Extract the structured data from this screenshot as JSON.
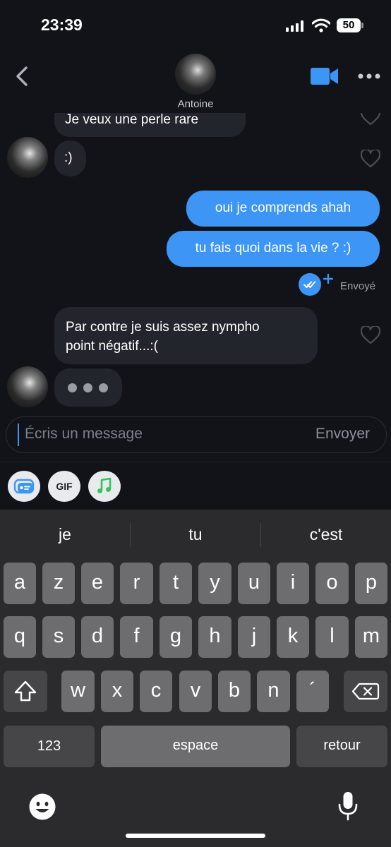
{
  "status_bar": {
    "time": "23:39",
    "battery": "50"
  },
  "header": {
    "contact_name": "Antoine"
  },
  "messages": {
    "partial_top": "Je veux une perle rare",
    "in_1": ":)",
    "out_1": "oui je comprends ahah",
    "out_2": "tu fais quoi dans la vie ? :)",
    "receipt": "Envoyé",
    "in_2_line1": "Par contre je suis assez nympho",
    "in_2_line2": "point négatif...:("
  },
  "composer": {
    "placeholder": "Écris un message",
    "send_label": "Envoyer",
    "gif_label": "GIF"
  },
  "keyboard": {
    "suggestions": [
      "je",
      "tu",
      "c'est"
    ],
    "row1": [
      "a",
      "z",
      "e",
      "r",
      "t",
      "y",
      "u",
      "i",
      "o",
      "p"
    ],
    "row2": [
      "q",
      "s",
      "d",
      "f",
      "g",
      "h",
      "j",
      "k",
      "l",
      "m"
    ],
    "row3": [
      "w",
      "x",
      "c",
      "v",
      "b",
      "n",
      "´"
    ],
    "numbers_label": "123",
    "space_label": "espace",
    "return_label": "retour"
  },
  "colors": {
    "accent": "#3d96f5",
    "background": "#111318",
    "incoming_bubble": "#23252d"
  },
  "icons": [
    "back-chevron-icon",
    "video-call-icon",
    "more-icon",
    "heart-icon",
    "read-receipt-icon",
    "quick-reply-icon",
    "gif-icon",
    "music-icon",
    "shift-icon",
    "backspace-icon",
    "emoji-icon",
    "microphone-icon"
  ]
}
